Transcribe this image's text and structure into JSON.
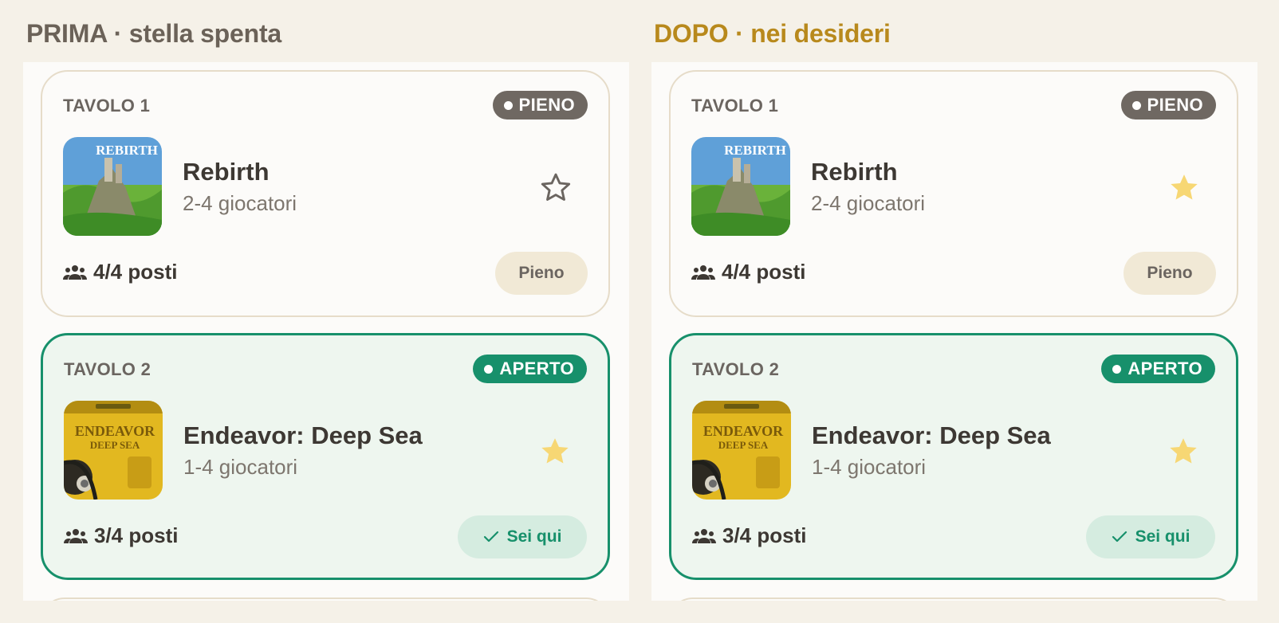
{
  "panels": [
    {
      "title": "PRIMA · stella spenta",
      "tables": [
        {
          "label": "TAVOLO 1",
          "status": "PIENO",
          "game": "Rebirth",
          "players": "2-4 giocatori",
          "seats": "4/4 posti",
          "action": "Pieno",
          "wishlisted": false
        },
        {
          "label": "TAVOLO 2",
          "status": "APERTO",
          "game": "Endeavor: Deep Sea",
          "players": "1-4 giocatori",
          "seats": "3/4 posti",
          "action": "Sei qui",
          "wishlisted": true
        }
      ]
    },
    {
      "title": "DOPO · nei desideri",
      "tables": [
        {
          "label": "TAVOLO 1",
          "status": "PIENO",
          "game": "Rebirth",
          "players": "2-4 giocatori",
          "seats": "4/4 posti",
          "action": "Pieno",
          "wishlisted": true
        },
        {
          "label": "TAVOLO 2",
          "status": "APERTO",
          "game": "Endeavor: Deep Sea",
          "players": "1-4 giocatori",
          "seats": "3/4 posti",
          "action": "Sei qui",
          "wishlisted": true
        }
      ]
    }
  ],
  "covers": {
    "rebirth": "REBIRTH",
    "endeavor_line1": "ENDEAVOR",
    "endeavor_line2": "DEEP SEA"
  },
  "icons": {
    "star_off": "star-outline-icon",
    "star_on": "star-filled-icon",
    "seats": "people-icon",
    "check": "check-icon"
  },
  "colors": {
    "before_title": "#6b6258",
    "after_title": "#b8891c",
    "accent_green": "#17906b",
    "star_gold": "#f7d774",
    "badge_full": "#6f6862"
  }
}
